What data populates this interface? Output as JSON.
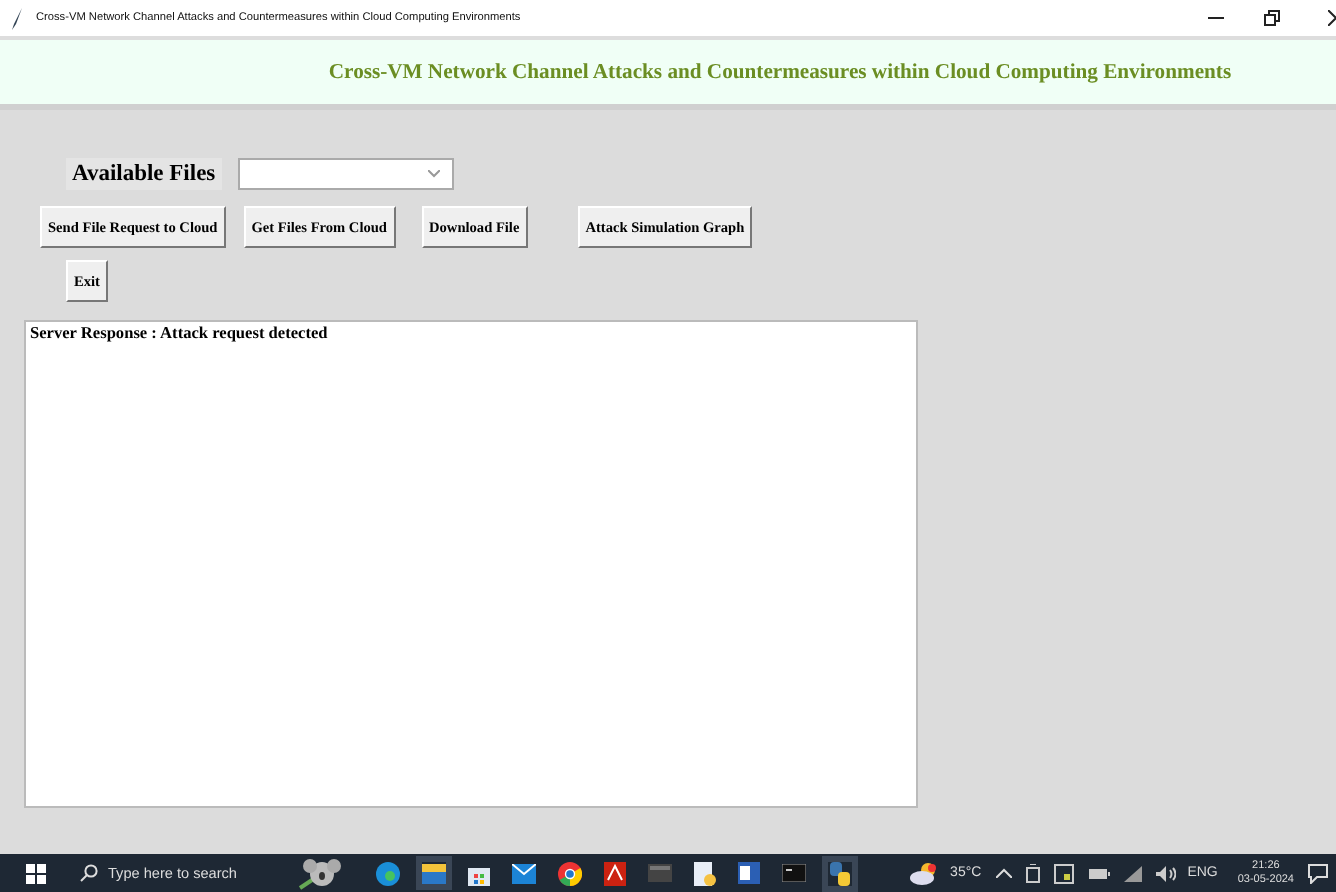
{
  "window": {
    "title": "Cross-VM Network Channel Attacks and Countermeasures within Cloud Computing Environments"
  },
  "header": {
    "title": "Cross-VM Network Channel Attacks and Countermeasures within Cloud Computing Environments"
  },
  "files": {
    "label": "Available Files"
  },
  "buttons": [
    "Send File Request to Cloud",
    "Get Files From Cloud",
    "Download File",
    "Attack Simulation Graph"
  ],
  "exit_button": "Exit",
  "output": {
    "text": "Server Response : Attack request detected"
  },
  "taskbar": {
    "search_placeholder": "Type here to search",
    "temperature": "35°C",
    "language": "ENG",
    "time": "21:26",
    "date": "03-05-2024"
  }
}
